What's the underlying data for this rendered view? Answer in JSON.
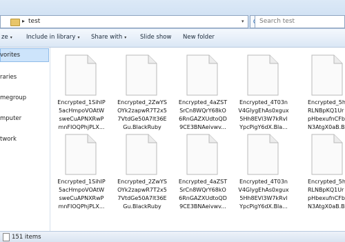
{
  "address": {
    "crumb_separator": "▸",
    "path": "test",
    "dropdown_glyph": "▾",
    "refresh_glyph": "⟳"
  },
  "search": {
    "placeholder": "Search test"
  },
  "toolbar": {
    "arrow": "▾",
    "items": [
      "ze",
      "Include in library",
      "Share with",
      "Slide show",
      "New folder"
    ]
  },
  "nav": {
    "items": [
      "vorites",
      "raries",
      "megroup",
      "mputer",
      "twork"
    ]
  },
  "files": [
    {
      "line1": "Encrypted_1SihIP",
      "line2": "5acHmpoVOAtW",
      "line3": "sweCuAPNXRwP",
      "line4": "mnFIOQPhjPLX..."
    },
    {
      "line1": "Encrypted_2ZwYS",
      "line2": "OYk2zapwR7T2x5",
      "line3": "7VtdGe50A7lt36E",
      "line4": "Gu.BlackRuby"
    },
    {
      "line1": "Encrypted_4aZST",
      "line2": "SrCn8WQrY68kO",
      "line3": "6RnGAZXUdtoQD",
      "line4": "9CE3BNAeivwv..."
    },
    {
      "line1": "Encrypted_4T03n",
      "line2": "V4GlygEhAs0xgux",
      "line3": "5Hh8EVl3W7kRvl",
      "line4": "YpcPigY6dX.Bla..."
    },
    {
      "line1": "Encrypted_5h",
      "line2": "RLNBpKQ1Ur",
      "line3": "pHbexufnCFb",
      "line4": "N3AtgX0aB.B"
    },
    {
      "line1": "Encrypted_1SihIP",
      "line2": "5acHmpoVOAtW",
      "line3": "sweCuAPNXRwP",
      "line4": "mnFIOQPhjPLX..."
    },
    {
      "line1": "Encrypted_2ZwYS",
      "line2": "OYk2zapwR7T2x5",
      "line3": "7VtdGe50A7lt36E",
      "line4": "Gu.BlackRuby"
    },
    {
      "line1": "Encrypted_4aZST",
      "line2": "SrCn8WQrY68kO",
      "line3": "6RnGAZXUdtoQD",
      "line4": "9CE3BNAeivwv..."
    },
    {
      "line1": "Encrypted_4T03n",
      "line2": "V4GlygEhAs0xgux",
      "line3": "5Hh8EVl3W7kRvl",
      "line4": "YpcPigY6dX.Bla..."
    },
    {
      "line1": "Encrypted_5h",
      "line2": "RLNBpKQ1Ur",
      "line3": "pHbexufnCFb",
      "line4": "N3AtgX0aB.B"
    }
  ],
  "status": {
    "text": "151 items"
  }
}
